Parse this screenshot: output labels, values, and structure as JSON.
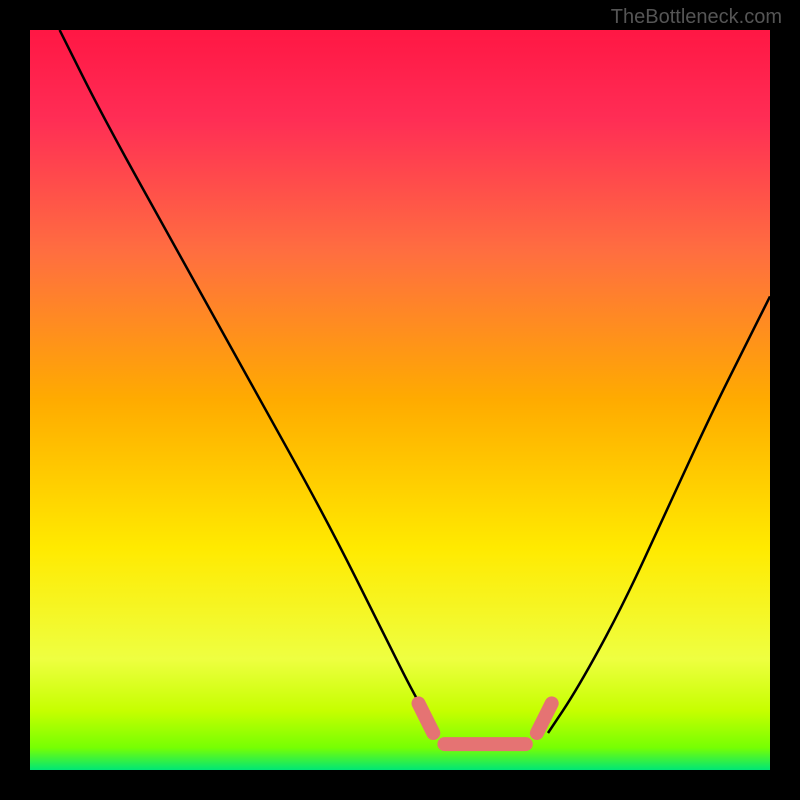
{
  "watermark": "TheBottleneck.com",
  "chart_data": {
    "type": "line",
    "title": "",
    "xlabel": "",
    "ylabel": "",
    "xlim": [
      0,
      100
    ],
    "ylim": [
      0,
      100
    ],
    "gradient_stops": [
      {
        "pos": 0.0,
        "color": "#ff1744"
      },
      {
        "pos": 0.12,
        "color": "#ff2d55"
      },
      {
        "pos": 0.3,
        "color": "#ff6e40"
      },
      {
        "pos": 0.5,
        "color": "#ffab00"
      },
      {
        "pos": 0.7,
        "color": "#ffea00"
      },
      {
        "pos": 0.85,
        "color": "#eeff41"
      },
      {
        "pos": 0.92,
        "color": "#c6ff00"
      },
      {
        "pos": 0.97,
        "color": "#76ff03"
      },
      {
        "pos": 1.0,
        "color": "#00e676"
      }
    ],
    "series": [
      {
        "name": "curve-left",
        "color": "#000000",
        "points": [
          {
            "x": 4,
            "y": 100
          },
          {
            "x": 10,
            "y": 88
          },
          {
            "x": 20,
            "y": 70
          },
          {
            "x": 30,
            "y": 52
          },
          {
            "x": 40,
            "y": 34
          },
          {
            "x": 48,
            "y": 18
          },
          {
            "x": 52,
            "y": 10
          },
          {
            "x": 55,
            "y": 5
          }
        ]
      },
      {
        "name": "curve-right",
        "color": "#000000",
        "points": [
          {
            "x": 70,
            "y": 5
          },
          {
            "x": 74,
            "y": 11
          },
          {
            "x": 80,
            "y": 22
          },
          {
            "x": 86,
            "y": 35
          },
          {
            "x": 92,
            "y": 48
          },
          {
            "x": 97,
            "y": 58
          },
          {
            "x": 100,
            "y": 64
          }
        ]
      }
    ],
    "markers": [
      {
        "name": "left-capsule-1",
        "x1": 52.5,
        "y1": 9,
        "x2": 54.5,
        "y2": 5,
        "color": "#e57373"
      },
      {
        "name": "bottom-capsule",
        "x1": 56,
        "y1": 3.5,
        "x2": 67,
        "y2": 3.5,
        "color": "#e57373"
      },
      {
        "name": "right-capsule-1",
        "x1": 68.5,
        "y1": 5,
        "x2": 70.5,
        "y2": 9,
        "color": "#e57373"
      }
    ]
  }
}
